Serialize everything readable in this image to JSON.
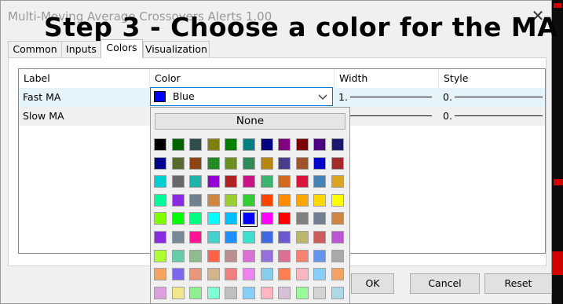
{
  "dialog": {
    "title": "Multi-Moving Average Crossovers Alerts 1.00",
    "close_glyph": "✕",
    "overlay_caption": "Step 3 - Choose a color for the MA"
  },
  "tabs": [
    {
      "label": "Common",
      "active": false
    },
    {
      "label": "Inputs",
      "active": false
    },
    {
      "label": "Colors",
      "active": true
    },
    {
      "label": "Visualization",
      "active": false
    }
  ],
  "table": {
    "columns": [
      "Label",
      "Color",
      "Width",
      "Style"
    ],
    "rows": [
      {
        "label": "Fast MA",
        "width": "1.",
        "style": "0."
      },
      {
        "label": "Slow MA",
        "width": "",
        "style": "0."
      }
    ]
  },
  "color_select": {
    "value": "Blue",
    "swatch_color": "#0000ff",
    "arrow_icon": "chevron-down-icon"
  },
  "palette": {
    "none_label": "None",
    "selected_color": "#0000ff",
    "colors": [
      [
        "#000000",
        "#006400",
        "#2f4f4f",
        "#808000",
        "#008000",
        "#008080",
        "#000080",
        "#800080",
        "#800000",
        "#4b0082",
        "#191970"
      ],
      [
        "#00008b",
        "#556b2f",
        "#8b4513",
        "#228b22",
        "#6b8e23",
        "#2e8b57",
        "#b8860b",
        "#483d8b",
        "#a0522d",
        "#0000cd",
        "#a52a2a"
      ],
      [
        "#00ced1",
        "#696969",
        "#20b2aa",
        "#9400d3",
        "#b22222",
        "#c71585",
        "#3cb371",
        "#d2691e",
        "#dc143c",
        "#4682b4",
        "#daa520"
      ],
      [
        "#00fa9a",
        "#8a2be2",
        "#708090",
        "#cd853f",
        "#9acd32",
        "#32cd32",
        "#ff4500",
        "#ff8c00",
        "#ffa500",
        "#ffd700",
        "#ffff00"
      ],
      [
        "#7fff00",
        "#00ff00",
        "#00ff7f",
        "#00ffff",
        "#00bfff",
        "#0000ff",
        "#ff00ff",
        "#ff0000",
        "#808080",
        "#708090",
        "#cd853f"
      ],
      [
        "#8a2be2",
        "#778899",
        "#ff1493",
        "#48d1cc",
        "#1e90ff",
        "#40e0d0",
        "#4169e1",
        "#6a5acd",
        "#bdb76b",
        "#cd5c5c",
        "#ba55d3"
      ],
      [
        "#adff2f",
        "#66cdaa",
        "#8fbc8f",
        "#ff6347",
        "#bc8f8f",
        "#da70d6",
        "#9370db",
        "#db7093",
        "#fa8072",
        "#6495ed",
        "#a9a9a9"
      ],
      [
        "#f4a460",
        "#7b68ee",
        "#e9967a",
        "#d2b48c",
        "#f08080",
        "#ee82ee",
        "#87ceeb",
        "#ff7f50",
        "#ffb6c1",
        "#87cefa",
        "#f4a460"
      ],
      [
        "#dda0dd",
        "#f0e68c",
        "#90ee90",
        "#7fffd4",
        "#c0c0c0",
        "#87cefa",
        "#ffb6c1",
        "#d8bfd8",
        "#98fb98",
        "#d3d3d3",
        "#add8e6"
      ],
      [
        "#f5deb3",
        "#e0ffff",
        "#ffe4b5",
        "#ffe4e1",
        "#e6e6fa",
        "#fffacd",
        "#ffdab9",
        "#ffe4c4",
        "#eee8aa",
        "#ffefd5",
        "#fff0f5"
      ]
    ]
  },
  "buttons": {
    "ok": "OK",
    "cancel": "Cancel",
    "reset": "Reset"
  }
}
